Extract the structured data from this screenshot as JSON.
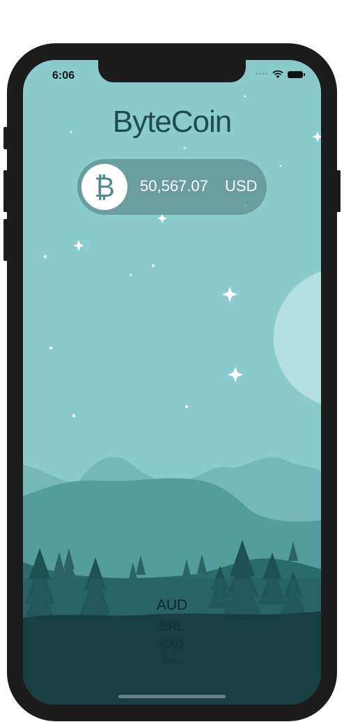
{
  "status_bar": {
    "time": "6:06",
    "signal_dots": "••••"
  },
  "app": {
    "title": "ByteCoin"
  },
  "price": {
    "value": "50,567.07",
    "currency": "USD",
    "coin_symbol": "₿"
  },
  "picker": {
    "options": [
      "AUD",
      "BRL",
      "CAD",
      "CNY"
    ],
    "selected": "AUD"
  },
  "colors": {
    "sky": "#8bcbcc",
    "title": "#1f4b55",
    "forest": "#173f42",
    "moon": "#b4e0e1"
  },
  "icons": [
    "bitcoin-icon",
    "wifi-icon",
    "battery-icon",
    "signal-icon"
  ]
}
